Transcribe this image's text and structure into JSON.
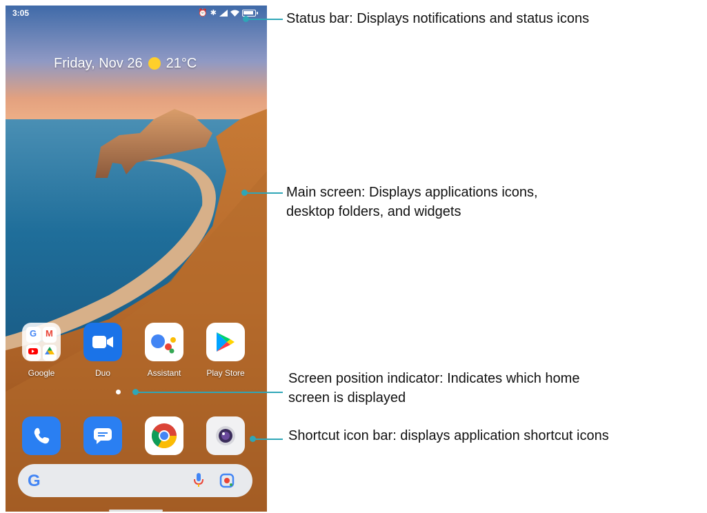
{
  "phone": {
    "status_bar": {
      "time": "3:05"
    },
    "widget": {
      "date": "Friday, Nov 26",
      "temperature": "21°C"
    },
    "apps": [
      {
        "label": "Google",
        "icon": "google-apps-folder-icon"
      },
      {
        "label": "Duo",
        "icon": "duo-video-icon"
      },
      {
        "label": "Assistant",
        "icon": "google-assistant-icon"
      },
      {
        "label": "Play Store",
        "icon": "play-store-icon"
      }
    ],
    "dock": [
      {
        "icon": "phone-icon"
      },
      {
        "icon": "messages-icon"
      },
      {
        "icon": "chrome-icon"
      },
      {
        "icon": "camera-icon"
      }
    ],
    "search_bar": {
      "logo": "G"
    }
  },
  "callouts": [
    {
      "text": "Status bar:  Displays notifications and status icons"
    },
    {
      "text": "Main screen: Displays applications icons,\ndesktop folders, and widgets"
    },
    {
      "text": "Screen position indicator: Indicates which home\nscreen is displayed"
    },
    {
      "text": "Shortcut icon bar: displays application shortcut icons"
    }
  ],
  "colors": {
    "callout": "#2ea6b7",
    "phone_blue": "#2a7ff2",
    "duo_blue": "#1a73e8"
  }
}
